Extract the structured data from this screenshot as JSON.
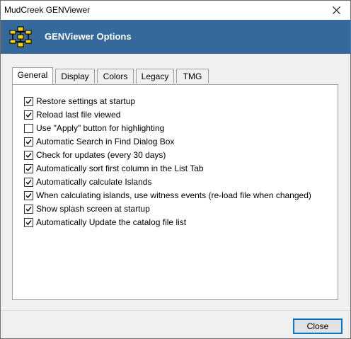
{
  "window": {
    "title": "MudCreek GENViewer"
  },
  "header": {
    "title": "GENViewer Options"
  },
  "tabs": [
    {
      "label": "General",
      "active": true
    },
    {
      "label": "Display",
      "active": false
    },
    {
      "label": "Colors",
      "active": false
    },
    {
      "label": "Legacy",
      "active": false
    },
    {
      "label": "TMG",
      "active": false
    }
  ],
  "options": [
    {
      "label": "Restore settings at startup",
      "checked": true
    },
    {
      "label": "Reload last file viewed",
      "checked": true
    },
    {
      "label": "Use \"Apply\" button for highlighting",
      "checked": false
    },
    {
      "label": "Automatic Search in Find Dialog Box",
      "checked": true
    },
    {
      "label": "Check for updates (every 30 days)",
      "checked": true
    },
    {
      "label": "Automatically sort first column in the List Tab",
      "checked": true
    },
    {
      "label": "Automatically calculate Islands",
      "checked": true
    },
    {
      "label": "When calculating islands, use witness events (re-load file when changed)",
      "checked": true
    },
    {
      "label": "Show splash screen at startup",
      "checked": true
    },
    {
      "label": "Automatically Update the catalog file list",
      "checked": true
    }
  ],
  "footer": {
    "close_label": "Close"
  },
  "colors": {
    "header_bg": "#36699b",
    "accent": "#0078d7"
  }
}
